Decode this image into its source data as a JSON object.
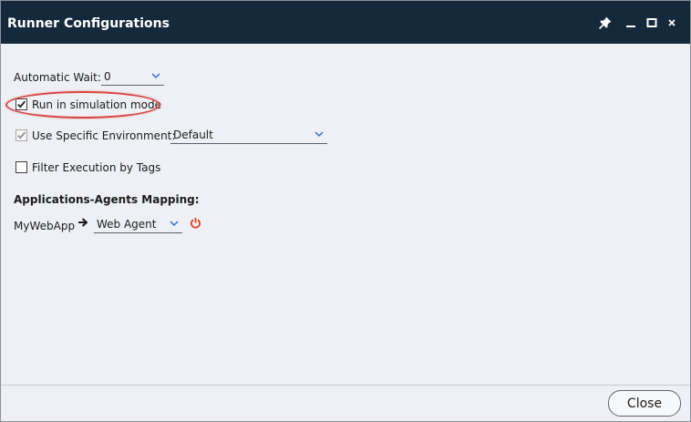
{
  "window": {
    "title": "Runner Configurations",
    "accent_color": "#142a3c",
    "controls": [
      "pin-icon",
      "minimize-icon",
      "maximize-icon",
      "close-icon"
    ]
  },
  "settings": {
    "automatic_wait": {
      "label": "Automatic Wait:",
      "value": "0"
    },
    "simulation_mode": {
      "label": "Run in simulation mode",
      "checked": true
    },
    "specific_environment": {
      "label": "Use Specific Environment:",
      "checked": true,
      "disabled": true,
      "value": "Default"
    },
    "filter_by_tags": {
      "label": "Filter Execution by Tags",
      "checked": false
    }
  },
  "mapping": {
    "heading": "Applications-Agents Mapping:",
    "rows": [
      {
        "application": "MyWebApp",
        "agent": "Web Agent",
        "status_icon": "power-icon",
        "status_color": "#e2411f"
      }
    ]
  },
  "footer": {
    "close_label": "Close"
  },
  "annotation": {
    "highlight_color": "#d9443f"
  }
}
